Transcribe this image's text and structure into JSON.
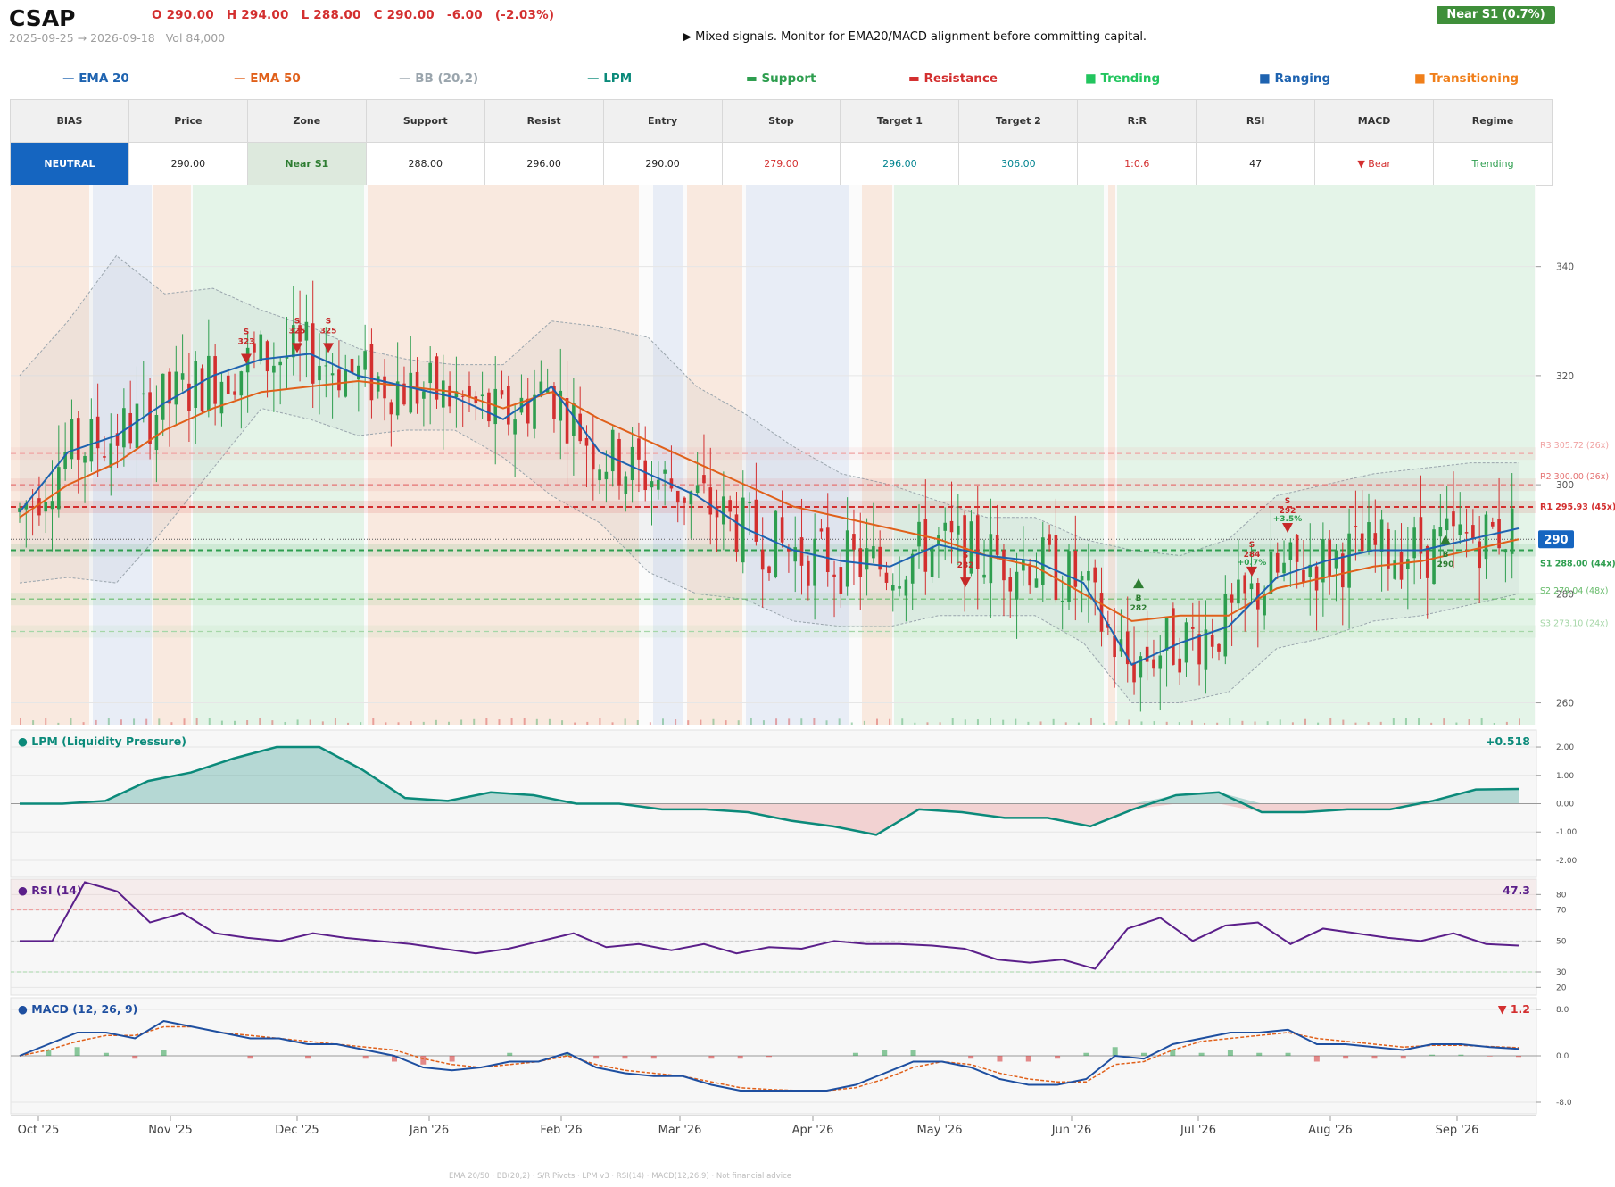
{
  "header": {
    "ticker": "CSAP",
    "ohlc": {
      "open": "O 290.00",
      "high": "H 294.00",
      "low": "L 288.00",
      "close": "C 290.00",
      "change": "-6.00",
      "change_pct": "(-2.03%)"
    },
    "date_range": "2025-09-25 → 2026-09-18",
    "volume": "Vol 84,000",
    "signal_text": "▶  Mixed signals. Monitor for EMA20/MACD alignment before committing capital.",
    "zone_badge": "Near S1  (0.7%)"
  },
  "legend": [
    {
      "label": "— EMA 20",
      "color": "#1e63b0"
    },
    {
      "label": "— EMA 50",
      "color": "#e0601a"
    },
    {
      "label": "— BB (20,2)",
      "color": "#9aa5ad"
    },
    {
      "label": "— LPM",
      "color": "#0b8a7a"
    },
    {
      "label": "▬  Support",
      "color": "#2e9e4f"
    },
    {
      "label": "▬  Resistance",
      "color": "#d32f2f"
    },
    {
      "label": "■  Trending",
      "color": "#22c55e"
    },
    {
      "label": "■  Ranging",
      "color": "#1e63b0"
    },
    {
      "label": "■  Transitioning",
      "color": "#f07f1a"
    }
  ],
  "table": {
    "headers": [
      "BIAS",
      "Price",
      "Zone",
      "Support",
      "Resist",
      "Entry",
      "Stop",
      "Target 1",
      "Target 2",
      "R:R",
      "RSI",
      "MACD",
      "Regime"
    ],
    "values": [
      "NEUTRAL",
      "290.00",
      "Near S1",
      "288.00",
      "296.00",
      "290.00",
      "279.00",
      "296.00",
      "306.00",
      "1:0.6",
      "47",
      "▼ Bear",
      "Trending"
    ]
  },
  "colors": {
    "up": "#2e9e4f",
    "down": "#d32f2f",
    "ema20": "#1e63b0",
    "ema50": "#e0601a",
    "bb": "#9aa5ad",
    "lpm": "#0b8a7a",
    "rsi": "#5b1f8a",
    "macd": "#1e4fa0",
    "signal": "#e0601a",
    "trending_bg": "#e4f4e8",
    "ranging_bg": "#e8edf6",
    "transition_bg": "#f9e9df"
  },
  "chart_data": [
    {
      "type": "candlestick",
      "name": "CSAP price",
      "x_ticks": [
        "Oct '25",
        "Nov '25",
        "Dec '25",
        "Jan '26",
        "Feb '26",
        "Mar '26",
        "Apr '26",
        "May '26",
        "Jun '26",
        "Jul '26",
        "Aug '26",
        "Sep '26"
      ],
      "y_ticks": [
        260,
        280,
        300,
        320,
        340
      ],
      "ylim": [
        256,
        355
      ],
      "last_price": "290",
      "ema20": [
        295,
        306,
        309,
        315,
        320,
        323,
        324,
        320,
        318,
        316,
        312,
        318,
        306,
        302,
        298,
        292,
        288,
        286,
        285,
        289,
        287,
        286,
        282,
        267,
        271,
        274,
        283,
        286,
        288,
        288,
        290,
        292
      ],
      "ema50": [
        294,
        300,
        304,
        310,
        314,
        317,
        318,
        319,
        318,
        317,
        314,
        317,
        312,
        308,
        304,
        300,
        296,
        294,
        292,
        290,
        287,
        285,
        280,
        275,
        276,
        276,
        281,
        283,
        285,
        286,
        288,
        290
      ],
      "bb_upper": [
        320,
        330,
        342,
        335,
        336,
        332,
        329,
        325,
        323,
        322,
        322,
        330,
        329,
        327,
        318,
        313,
        307,
        302,
        300,
        297,
        294,
        294,
        290,
        288,
        287,
        290,
        298,
        300,
        302,
        303,
        304,
        304
      ],
      "bb_lower": [
        282,
        283,
        282,
        292,
        303,
        314,
        312,
        309,
        310,
        310,
        305,
        298,
        293,
        284,
        280,
        279,
        275,
        274,
        274,
        276,
        276,
        276,
        271,
        260,
        260,
        262,
        270,
        272,
        275,
        276,
        278,
        280
      ],
      "levels": [
        {
          "label": "R3 305.72 (26x)",
          "value": 305.72,
          "color": "#f0a3a3"
        },
        {
          "label": "R2 300.00 (26x)",
          "value": 300.0,
          "color": "#e57373"
        },
        {
          "label": "R1 295.93 (45x)",
          "value": 295.93,
          "color": "#d32f2f"
        },
        {
          "label": "S1 288.00 (44x)",
          "value": 288.0,
          "color": "#2e9e4f"
        },
        {
          "label": "S2 279.04 (48x)",
          "value": 279.04,
          "color": "#66bb6a"
        },
        {
          "label": "S3 273.10 (24x)",
          "value": 273.1,
          "color": "#a5d6a7"
        }
      ],
      "annotations": [
        {
          "label": "S",
          "price": "323",
          "type": "sell"
        },
        {
          "label": "S",
          "price": "325",
          "type": "sell"
        },
        {
          "label": "S",
          "price": "325",
          "type": "sell"
        },
        {
          "label": "S",
          "price": "282",
          "type": "sell"
        },
        {
          "label": "B",
          "price": "282",
          "type": "buy"
        },
        {
          "label": "S",
          "price": "284",
          "pct": "+0.7%",
          "type": "sell"
        },
        {
          "label": "S",
          "price": "292",
          "pct": "+3.5%",
          "type": "sell"
        },
        {
          "label": "B",
          "price": "290",
          "type": "buy"
        }
      ]
    },
    {
      "type": "area",
      "name": "LPM (Liquidity Pressure)",
      "title": "● LPM (Liquidity Pressure)",
      "last_value": "+0.518",
      "y_ticks": [
        "2.00",
        "1.00",
        "0.00",
        "-1.00",
        "-2.00"
      ],
      "ylim": [
        -2.6,
        2.6
      ],
      "values": [
        0,
        0,
        0.1,
        0.8,
        1.1,
        1.6,
        2.0,
        2.0,
        1.2,
        0.2,
        0.1,
        0.4,
        0.3,
        0.0,
        0.0,
        -0.2,
        -0.2,
        -0.3,
        -0.6,
        -0.8,
        -1.1,
        -0.2,
        -0.3,
        -0.5,
        -0.5,
        -0.8,
        -0.2,
        0.3,
        0.4,
        -0.3,
        -0.3,
        -0.2,
        -0.2,
        0.1,
        0.5,
        0.52
      ]
    },
    {
      "type": "line",
      "name": "RSI (14)",
      "title": "● RSI (14)",
      "last_value": "47.3",
      "y_ticks": [
        "80",
        "70",
        "50",
        "30",
        "20"
      ],
      "ylim": [
        15,
        90
      ],
      "values": [
        50,
        50,
        88,
        82,
        62,
        68,
        55,
        52,
        50,
        55,
        52,
        50,
        48,
        45,
        42,
        45,
        50,
        55,
        46,
        48,
        44,
        48,
        42,
        46,
        45,
        50,
        48,
        48,
        47,
        45,
        38,
        36,
        38,
        32,
        58,
        65,
        50,
        60,
        62,
        48,
        58,
        55,
        52,
        50,
        55,
        48,
        47
      ]
    },
    {
      "type": "line",
      "name": "MACD (12, 26, 9)",
      "title": "● MACD (12, 26, 9)",
      "last_value": "▼ 1.2",
      "y_ticks": [
        "8.0",
        "0.0",
        "-8.0"
      ],
      "ylim": [
        -10,
        10
      ],
      "macd": [
        0,
        2,
        4,
        4,
        3,
        6,
        5,
        4,
        3,
        3,
        2,
        2,
        1,
        0,
        -2,
        -2.5,
        -2,
        -1,
        -1,
        0.5,
        -2,
        -3,
        -3.5,
        -3.5,
        -5,
        -6,
        -6,
        -6,
        -6,
        -5,
        -3,
        -1,
        -1,
        -2,
        -4,
        -5,
        -5,
        -4,
        0,
        -0.5,
        2,
        3,
        4,
        4,
        4.5,
        2,
        2,
        1.5,
        1,
        2,
        2,
        1.5,
        1.2
      ],
      "signal": [
        0,
        1,
        2.5,
        3.5,
        3.5,
        5,
        5,
        4,
        3.5,
        3,
        2.5,
        2,
        1.5,
        1,
        -0.5,
        -1.5,
        -2,
        -1.5,
        -1,
        0,
        -1.5,
        -2.5,
        -3,
        -3.5,
        -4.5,
        -5.5,
        -5.8,
        -6,
        -6,
        -5.5,
        -4,
        -2,
        -1,
        -1.5,
        -3,
        -4,
        -4.5,
        -4.5,
        -1.5,
        -1,
        1,
        2.5,
        3,
        3.5,
        4,
        3,
        2.5,
        2,
        1.5,
        1.8,
        1.8,
        1.6,
        1.4
      ]
    }
  ],
  "footer": "EMA 20/50  ·  BB(20,2)  ·  S/R Pivots  ·  LPM v3  ·  RSI(14)  ·  MACD(12,26,9)  ·  Not financial advice"
}
